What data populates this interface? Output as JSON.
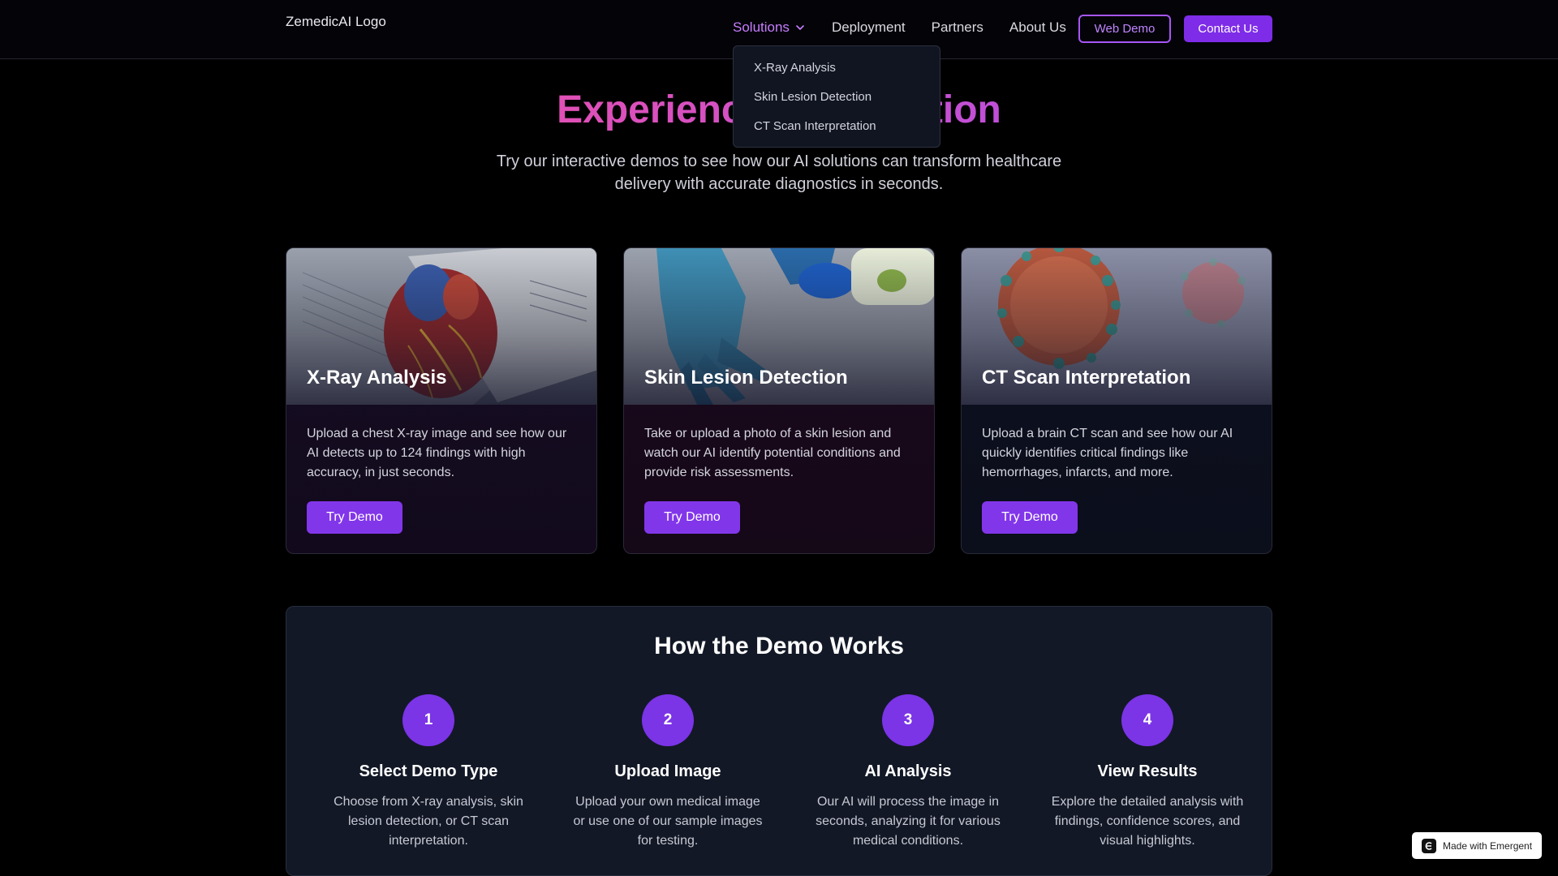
{
  "header": {
    "logo_alt": "ZemedicAI Logo",
    "nav": [
      {
        "label": "Solutions"
      },
      {
        "label": "Deployment"
      },
      {
        "label": "Partners"
      },
      {
        "label": "About Us"
      }
    ],
    "web_demo_label": "Web Demo",
    "contact_label": "Contact Us"
  },
  "dropdown": {
    "items": [
      "X-Ray Analysis",
      "Skin Lesion Detection",
      "CT Scan Interpretation"
    ]
  },
  "hero": {
    "title": "Experience AI Detection",
    "subtitle": "Try our interactive demos to see how our AI solutions can transform healthcare delivery with accurate diagnostics in seconds."
  },
  "cards": [
    {
      "title": "X-Ray Analysis",
      "description": "Upload a chest X-ray image and see how our AI detects up to 124 findings with high accuracy, in just seconds.",
      "button": "Try Demo"
    },
    {
      "title": "Skin Lesion Detection",
      "description": "Take or upload a photo of a skin lesion and watch our AI identify potential conditions and provide risk assessments.",
      "button": "Try Demo"
    },
    {
      "title": "CT Scan Interpretation",
      "description": "Upload a brain CT scan and see how our AI quickly identifies critical findings like hemorrhages, infarcts, and more.",
      "button": "Try Demo"
    }
  ],
  "how": {
    "title": "How the Demo Works",
    "steps": [
      {
        "num": "1",
        "title": "Select Demo Type",
        "desc": "Choose from X-ray analysis, skin lesion detection, or CT scan interpretation."
      },
      {
        "num": "2",
        "title": "Upload Image",
        "desc": "Upload your own medical image or use one of our sample images for testing."
      },
      {
        "num": "3",
        "title": "AI Analysis",
        "desc": "Our AI will process the image in seconds, analyzing it for various medical conditions."
      },
      {
        "num": "4",
        "title": "View Results",
        "desc": "Explore the detailed analysis with findings, confidence scores, and visual highlights."
      }
    ]
  },
  "badge": {
    "label": "Made with Emergent"
  },
  "colors": {
    "accent": "#8236ea",
    "nav_active": "#c77dff",
    "hero_gradient": "#d946a8"
  }
}
